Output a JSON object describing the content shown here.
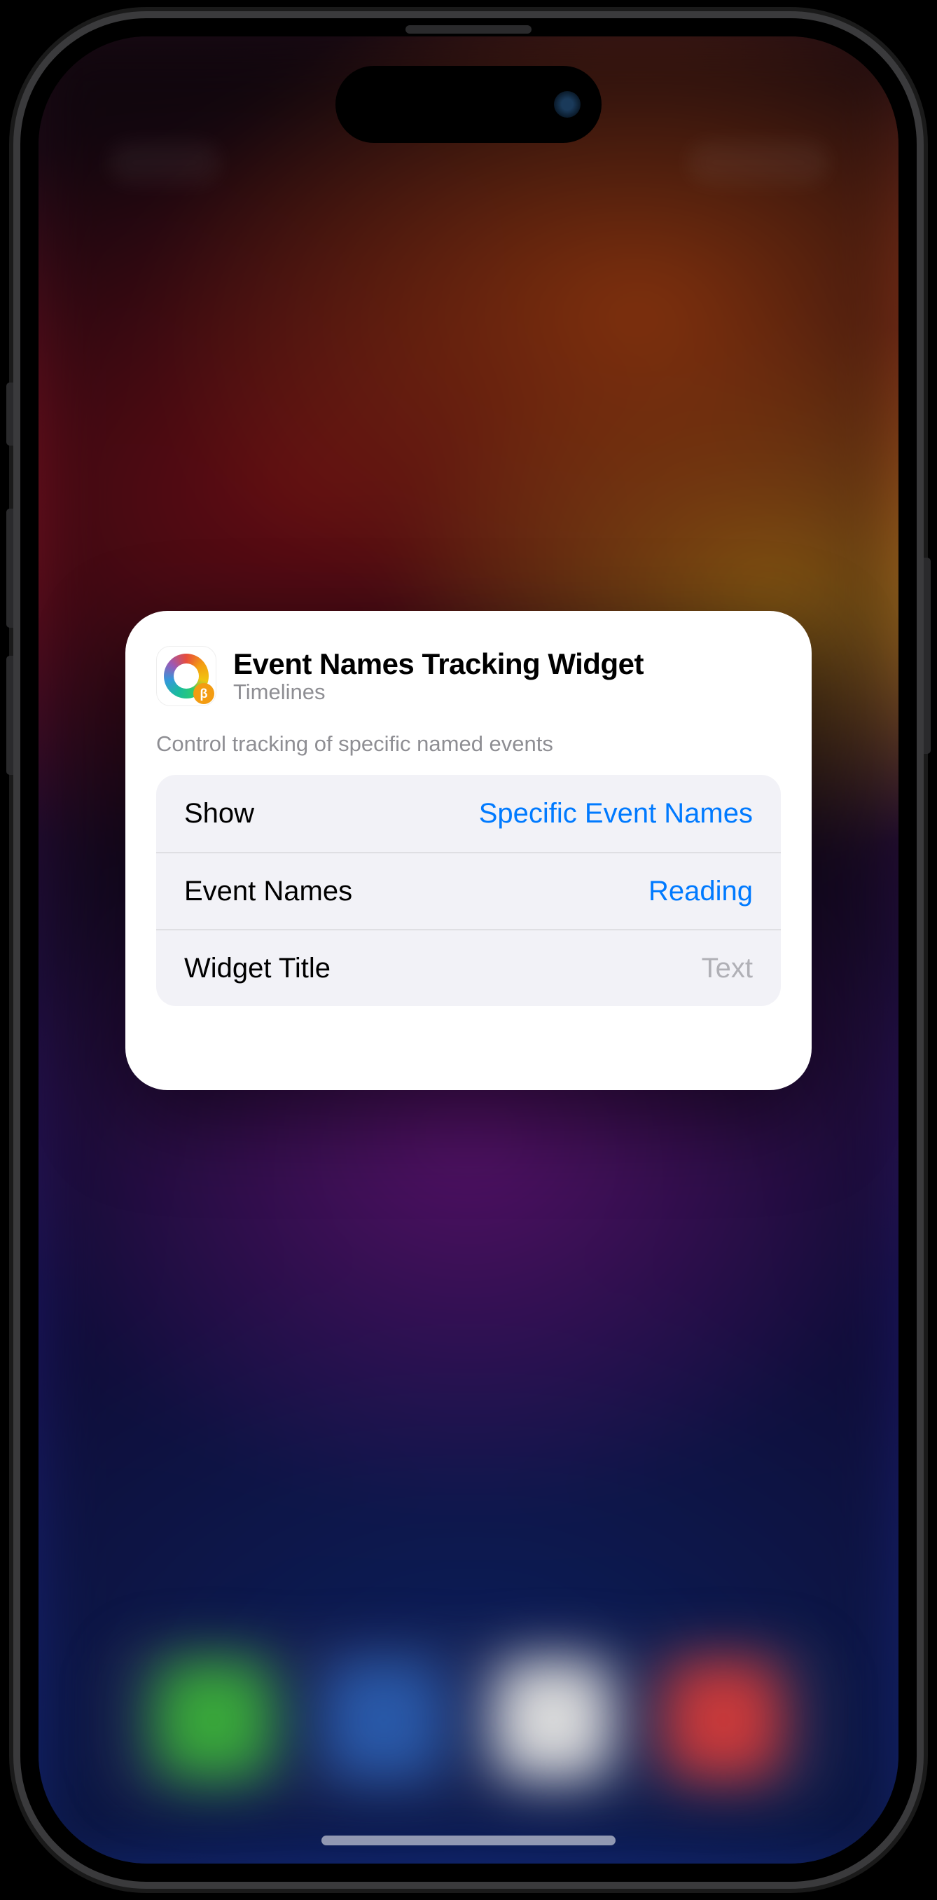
{
  "popover": {
    "title": "Event Names Tracking Widget",
    "subtitle": "Timelines",
    "description": "Control tracking of specific named events",
    "app_icon_badge": "β"
  },
  "settings": {
    "rows": [
      {
        "label": "Show",
        "value": "Specific Event Names",
        "type": "link"
      },
      {
        "label": "Event Names",
        "value": "Reading",
        "type": "link"
      },
      {
        "label": "Widget Title",
        "value": "Text",
        "type": "placeholder"
      }
    ]
  }
}
